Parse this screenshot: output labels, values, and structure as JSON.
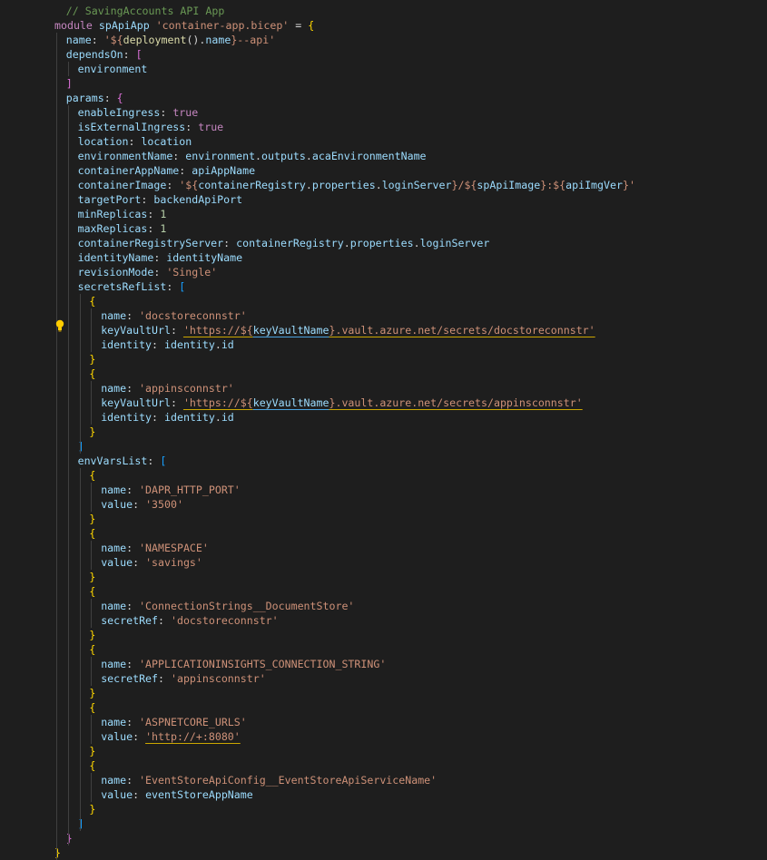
{
  "colors": {
    "background": "#1e1e1e",
    "comment": "#6a9955",
    "keyword": "#c586c0",
    "variable": "#9cdcfe",
    "property": "#9cdcfe",
    "string": "#ce9178",
    "function": "#dcdcaa",
    "bool": "#c586c0",
    "number": "#b5cea8",
    "punct": "#d4d4d4",
    "brace1": "#ffd700",
    "brace2": "#da70d6",
    "brace3": "#179fff",
    "lightbulb": "#ffcc00"
  },
  "lightbulb_line": 22,
  "lines": [
    {
      "i": 1,
      "t": [
        [
          "c",
          "// SavingAccounts API App"
        ]
      ]
    },
    {
      "i": 0,
      "t": [
        [
          "k",
          "module "
        ],
        [
          "v",
          "spApiApp "
        ],
        [
          "s",
          "'container-app.bicep'"
        ],
        [
          "p",
          " = "
        ],
        [
          "b1",
          "{"
        ]
      ]
    },
    {
      "i": 1,
      "t": [
        [
          "pr",
          "name"
        ],
        [
          "p",
          ": "
        ],
        [
          "s",
          "'${"
        ],
        [
          "f",
          "deployment"
        ],
        [
          "p",
          "()."
        ],
        [
          "v",
          "name"
        ],
        [
          "s",
          "}--api'"
        ]
      ]
    },
    {
      "i": 1,
      "t": [
        [
          "pr",
          "dependsOn"
        ],
        [
          "p",
          ": "
        ],
        [
          "b2",
          "["
        ]
      ]
    },
    {
      "i": 2,
      "t": [
        [
          "v",
          "environment"
        ]
      ]
    },
    {
      "i": 1,
      "t": [
        [
          "b2",
          "]"
        ]
      ]
    },
    {
      "i": 1,
      "t": [
        [
          "pr",
          "params"
        ],
        [
          "p",
          ": "
        ],
        [
          "b2",
          "{"
        ]
      ]
    },
    {
      "i": 2,
      "t": [
        [
          "pr",
          "enableIngress"
        ],
        [
          "p",
          ": "
        ],
        [
          "k",
          "true"
        ]
      ]
    },
    {
      "i": 2,
      "t": [
        [
          "pr",
          "isExternalIngress"
        ],
        [
          "p",
          ": "
        ],
        [
          "k",
          "true"
        ]
      ]
    },
    {
      "i": 2,
      "t": [
        [
          "pr",
          "location"
        ],
        [
          "p",
          ": "
        ],
        [
          "v",
          "location"
        ]
      ]
    },
    {
      "i": 2,
      "t": [
        [
          "pr",
          "environmentName"
        ],
        [
          "p",
          ": "
        ],
        [
          "v",
          "environment"
        ],
        [
          "p",
          "."
        ],
        [
          "v",
          "outputs"
        ],
        [
          "p",
          "."
        ],
        [
          "v",
          "acaEnvironmentName"
        ]
      ]
    },
    {
      "i": 2,
      "t": [
        [
          "pr",
          "containerAppName"
        ],
        [
          "p",
          ": "
        ],
        [
          "v",
          "apiAppName"
        ]
      ]
    },
    {
      "i": 2,
      "t": [
        [
          "pr",
          "containerImage"
        ],
        [
          "p",
          ": "
        ],
        [
          "s",
          "'${"
        ],
        [
          "v",
          "containerRegistry"
        ],
        [
          "p",
          "."
        ],
        [
          "v",
          "properties"
        ],
        [
          "p",
          "."
        ],
        [
          "v",
          "loginServer"
        ],
        [
          "s",
          "}/${"
        ],
        [
          "v",
          "spApiImage"
        ],
        [
          "s",
          "}:${"
        ],
        [
          "v",
          "apiImgVer"
        ],
        [
          "s",
          "}'"
        ]
      ]
    },
    {
      "i": 2,
      "t": [
        [
          "pr",
          "targetPort"
        ],
        [
          "p",
          ": "
        ],
        [
          "v",
          "backendApiPort"
        ]
      ]
    },
    {
      "i": 2,
      "t": [
        [
          "pr",
          "minReplicas"
        ],
        [
          "p",
          ": "
        ],
        [
          "n",
          "1"
        ]
      ]
    },
    {
      "i": 2,
      "t": [
        [
          "pr",
          "maxReplicas"
        ],
        [
          "p",
          ": "
        ],
        [
          "n",
          "1"
        ]
      ]
    },
    {
      "i": 2,
      "t": [
        [
          "pr",
          "containerRegistryServer"
        ],
        [
          "p",
          ": "
        ],
        [
          "v",
          "containerRegistry"
        ],
        [
          "p",
          "."
        ],
        [
          "v",
          "properties"
        ],
        [
          "p",
          "."
        ],
        [
          "v",
          "loginServer"
        ]
      ]
    },
    {
      "i": 2,
      "t": [
        [
          "pr",
          "identityName"
        ],
        [
          "p",
          ": "
        ],
        [
          "v",
          "identityName"
        ]
      ]
    },
    {
      "i": 2,
      "t": [
        [
          "pr",
          "revisionMode"
        ],
        [
          "p",
          ": "
        ],
        [
          "s",
          "'Single'"
        ]
      ]
    },
    {
      "i": 2,
      "t": [
        [
          "pr",
          "secretsRefList"
        ],
        [
          "p",
          ": "
        ],
        [
          "b3",
          "["
        ]
      ]
    },
    {
      "i": 3,
      "t": [
        [
          "b1",
          "{"
        ]
      ]
    },
    {
      "i": 4,
      "t": [
        [
          "pr",
          "name"
        ],
        [
          "p",
          ": "
        ],
        [
          "s",
          "'docstoreconnstr'"
        ]
      ]
    },
    {
      "i": 4,
      "t": [
        [
          "pr",
          "keyVaultUrl"
        ],
        [
          "p",
          ": "
        ],
        [
          "sq",
          "'https://${"
        ],
        [
          "sq2v",
          "keyVaultName"
        ],
        [
          "sq",
          "}.vault.azure.net/secrets/docstoreconnstr'"
        ]
      ]
    },
    {
      "i": 4,
      "t": [
        [
          "pr",
          "identity"
        ],
        [
          "p",
          ": "
        ],
        [
          "v",
          "identity"
        ],
        [
          "p",
          "."
        ],
        [
          "v",
          "id"
        ]
      ]
    },
    {
      "i": 3,
      "t": [
        [
          "b1",
          "}"
        ]
      ]
    },
    {
      "i": 3,
      "t": [
        [
          "b1",
          "{"
        ]
      ]
    },
    {
      "i": 4,
      "t": [
        [
          "pr",
          "name"
        ],
        [
          "p",
          ": "
        ],
        [
          "s",
          "'appinsconnstr'"
        ]
      ]
    },
    {
      "i": 4,
      "t": [
        [
          "pr",
          "keyVaultUrl"
        ],
        [
          "p",
          ": "
        ],
        [
          "sq",
          "'https://${"
        ],
        [
          "sq2v",
          "keyVaultName"
        ],
        [
          "sq",
          "}.vault.azure.net/secrets/appinsconnstr'"
        ]
      ]
    },
    {
      "i": 4,
      "t": [
        [
          "pr",
          "identity"
        ],
        [
          "p",
          ": "
        ],
        [
          "v",
          "identity"
        ],
        [
          "p",
          "."
        ],
        [
          "v",
          "id"
        ]
      ]
    },
    {
      "i": 3,
      "t": [
        [
          "b1",
          "}"
        ]
      ]
    },
    {
      "i": 2,
      "t": [
        [
          "b3",
          "]"
        ]
      ]
    },
    {
      "i": 2,
      "t": [
        [
          "pr",
          "envVarsList"
        ],
        [
          "p",
          ": "
        ],
        [
          "b3",
          "["
        ]
      ]
    },
    {
      "i": 3,
      "t": [
        [
          "b1",
          "{"
        ]
      ]
    },
    {
      "i": 4,
      "t": [
        [
          "pr",
          "name"
        ],
        [
          "p",
          ": "
        ],
        [
          "s",
          "'DAPR_HTTP_PORT'"
        ]
      ]
    },
    {
      "i": 4,
      "t": [
        [
          "pr",
          "value"
        ],
        [
          "p",
          ": "
        ],
        [
          "s",
          "'3500'"
        ]
      ]
    },
    {
      "i": 3,
      "t": [
        [
          "b1",
          "}"
        ]
      ]
    },
    {
      "i": 3,
      "t": [
        [
          "b1",
          "{"
        ]
      ]
    },
    {
      "i": 4,
      "t": [
        [
          "pr",
          "name"
        ],
        [
          "p",
          ": "
        ],
        [
          "s",
          "'NAMESPACE'"
        ]
      ]
    },
    {
      "i": 4,
      "t": [
        [
          "pr",
          "value"
        ],
        [
          "p",
          ": "
        ],
        [
          "s",
          "'savings'"
        ]
      ]
    },
    {
      "i": 3,
      "t": [
        [
          "b1",
          "}"
        ]
      ]
    },
    {
      "i": 3,
      "t": [
        [
          "b1",
          "{"
        ]
      ]
    },
    {
      "i": 4,
      "t": [
        [
          "pr",
          "name"
        ],
        [
          "p",
          ": "
        ],
        [
          "s",
          "'ConnectionStrings__DocumentStore'"
        ]
      ]
    },
    {
      "i": 4,
      "t": [
        [
          "pr",
          "secretRef"
        ],
        [
          "p",
          ": "
        ],
        [
          "s",
          "'docstoreconnstr'"
        ]
      ]
    },
    {
      "i": 3,
      "t": [
        [
          "b1",
          "}"
        ]
      ]
    },
    {
      "i": 3,
      "t": [
        [
          "b1",
          "{"
        ]
      ]
    },
    {
      "i": 4,
      "t": [
        [
          "pr",
          "name"
        ],
        [
          "p",
          ": "
        ],
        [
          "s",
          "'APPLICATIONINSIGHTS_CONNECTION_STRING'"
        ]
      ]
    },
    {
      "i": 4,
      "t": [
        [
          "pr",
          "secretRef"
        ],
        [
          "p",
          ": "
        ],
        [
          "s",
          "'appinsconnstr'"
        ]
      ]
    },
    {
      "i": 3,
      "t": [
        [
          "b1",
          "}"
        ]
      ]
    },
    {
      "i": 3,
      "t": [
        [
          "b1",
          "{"
        ]
      ]
    },
    {
      "i": 4,
      "t": [
        [
          "pr",
          "name"
        ],
        [
          "p",
          ": "
        ],
        [
          "s",
          "'ASPNETCORE_URLS'"
        ]
      ]
    },
    {
      "i": 4,
      "t": [
        [
          "pr",
          "value"
        ],
        [
          "p",
          ": "
        ],
        [
          "sq",
          "'http://+:8080'"
        ]
      ]
    },
    {
      "i": 3,
      "t": [
        [
          "b1",
          "}"
        ]
      ]
    },
    {
      "i": 3,
      "t": [
        [
          "b1",
          "{"
        ]
      ]
    },
    {
      "i": 4,
      "t": [
        [
          "pr",
          "name"
        ],
        [
          "p",
          ": "
        ],
        [
          "s",
          "'EventStoreApiConfig__EventStoreApiServiceName'"
        ]
      ]
    },
    {
      "i": 4,
      "t": [
        [
          "pr",
          "value"
        ],
        [
          "p",
          ": "
        ],
        [
          "v",
          "eventStoreAppName"
        ]
      ]
    },
    {
      "i": 3,
      "t": [
        [
          "b1",
          "}"
        ]
      ]
    },
    {
      "i": 2,
      "t": [
        [
          "b3",
          "]"
        ]
      ]
    },
    {
      "i": 1,
      "t": [
        [
          "b2",
          "}"
        ]
      ]
    },
    {
      "i": 0,
      "t": [
        [
          "b1",
          "}"
        ]
      ]
    }
  ]
}
